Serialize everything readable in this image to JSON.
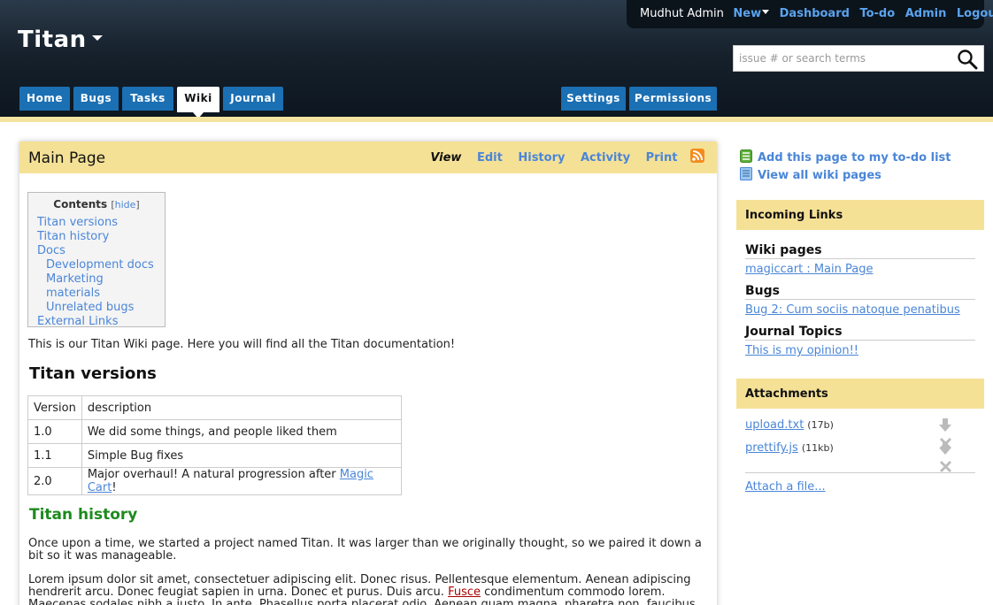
{
  "header": {
    "project": "Titan",
    "user": "Mudhut Admin",
    "menu": {
      "new": "New",
      "dashboard": "Dashboard",
      "todo": "To-do",
      "admin": "Admin",
      "logout": "Logout"
    },
    "search_placeholder": "issue # or search terms",
    "tabs": [
      {
        "label": "Home",
        "active": false
      },
      {
        "label": "Bugs",
        "active": false
      },
      {
        "label": "Tasks",
        "active": false
      },
      {
        "label": "Wiki",
        "active": true
      },
      {
        "label": "Journal",
        "active": false
      }
    ],
    "right_tabs": [
      {
        "label": "Settings"
      },
      {
        "label": "Permissions"
      }
    ]
  },
  "page": {
    "title": "Main Page",
    "actions": {
      "view": "View",
      "edit": "Edit",
      "history": "History",
      "activity": "Activity",
      "print": "Print"
    },
    "toc": {
      "title": "Contents",
      "hide": "hide",
      "items": [
        "Titan versions",
        "Titan history",
        "Docs",
        "Development docs",
        "Marketing materials",
        "Unrelated bugs",
        "External Links"
      ]
    },
    "intro": "This is our Titan Wiki page. Here you will find all the Titan documentation!",
    "versions_heading": "Titan versions",
    "table": {
      "headers": [
        "Version",
        "description"
      ],
      "rows": [
        [
          "1.0",
          "We did some things, and people liked them"
        ],
        [
          "1.1",
          "Simple Bug fixes"
        ],
        [
          "2.0",
          "Major overhaul! A natural progression after "
        ]
      ],
      "link_text": "Magic Cart",
      "link_suffix": "!"
    },
    "history_heading": "Titan history",
    "history_p1": "Once upon a time, we started a project named Titan. It was larger than we originally thought, so we paired it down a bit so it was manageable.",
    "history_p2_a": "Lorem ipsum dolor sit amet, consectetuer adipiscing elit. Donec risus. Pellentesque elementum. Aenean adipiscing hendrerit arcu. Donec feugiat sapien in urna. Donec et purus. Duis arcu. ",
    "history_p2_link": "Fusce",
    "history_p2_b": " condimentum commodo lorem. Maecenas sodales nibh a justo. In ante. Phasellus porta placerat odio. Aenean quam magna, pharetra non, faucibus id, bibendum"
  },
  "sidebar": {
    "add_todo": "Add this page to my to-do list",
    "view_all": "View all wiki pages",
    "incoming_title": "Incoming Links",
    "wiki_pages_title": "Wiki pages",
    "wiki_link": "magiccart : Main Page",
    "bugs_title": "Bugs",
    "bug_link": "Bug 2: Cum sociis natoque penatibus",
    "journal_title": "Journal Topics",
    "journal_link": "This is my opinion!!",
    "attachments_title": "Attachments",
    "attachments": [
      {
        "name": "upload.txt",
        "size": "(17b)"
      },
      {
        "name": "prettify.js",
        "size": "(11kb)"
      }
    ],
    "attach_file": "Attach a file..."
  },
  "colors": {
    "tab_blue": "#1b6fb3",
    "link": "#4a86d8",
    "highlight": "#f5e196",
    "history_green": "#1d8a1d"
  }
}
